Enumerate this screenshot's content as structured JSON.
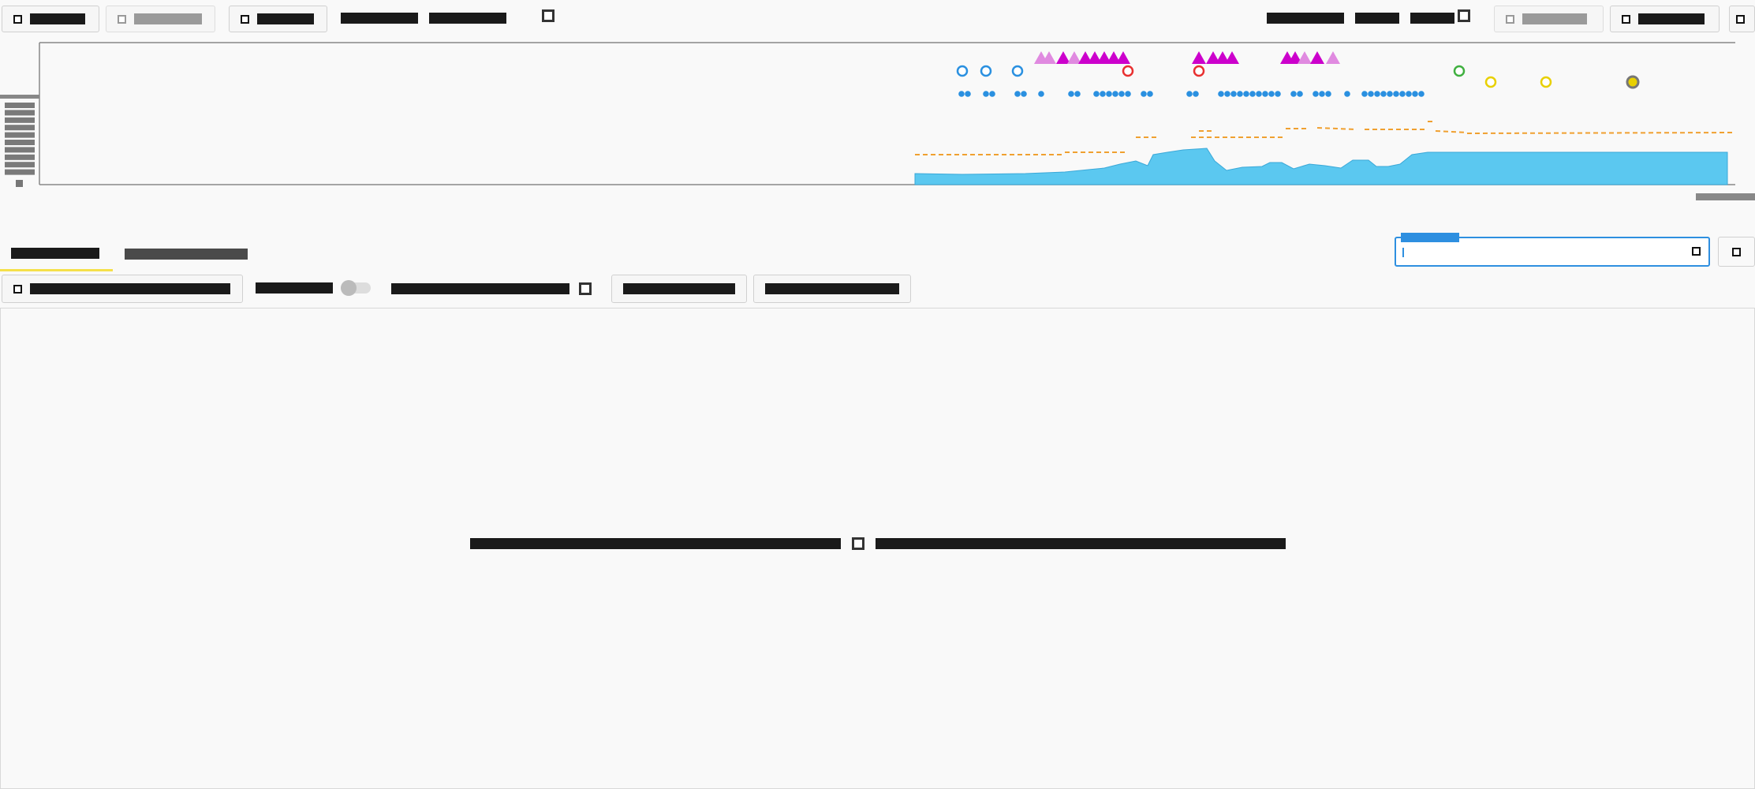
{
  "toolbar": {
    "left_buttons": [
      {
        "label": "",
        "disabled": false
      },
      {
        "label": "",
        "disabled": true
      },
      {
        "label": "",
        "disabled": false
      }
    ],
    "text_items": [
      "",
      ""
    ],
    "right_items": [
      "",
      "",
      ""
    ],
    "right_buttons": [
      {
        "label": "",
        "disabled": true
      },
      {
        "label": "",
        "disabled": false
      }
    ]
  },
  "timeline": {
    "y_axis_label": "",
    "colors": {
      "area": "#5bc8f0",
      "dashed": "#f0a030",
      "blue_dot": "#2a90e0",
      "triangle_dark": "#cc00cc",
      "triangle_light": "#e08ae0",
      "ring_blue": "#2a90e0",
      "ring_red": "#e83030",
      "ring_green": "#40b040",
      "ring_yellow": "#e8d000"
    }
  },
  "tabs": [
    "",
    ""
  ],
  "subtoolbar": {
    "filter_button": "",
    "toggle_label": "",
    "text_group": "",
    "btn_a": "",
    "btn_b": ""
  },
  "search": {
    "label": "",
    "value": ""
  },
  "content": {
    "empty_message": ""
  }
}
